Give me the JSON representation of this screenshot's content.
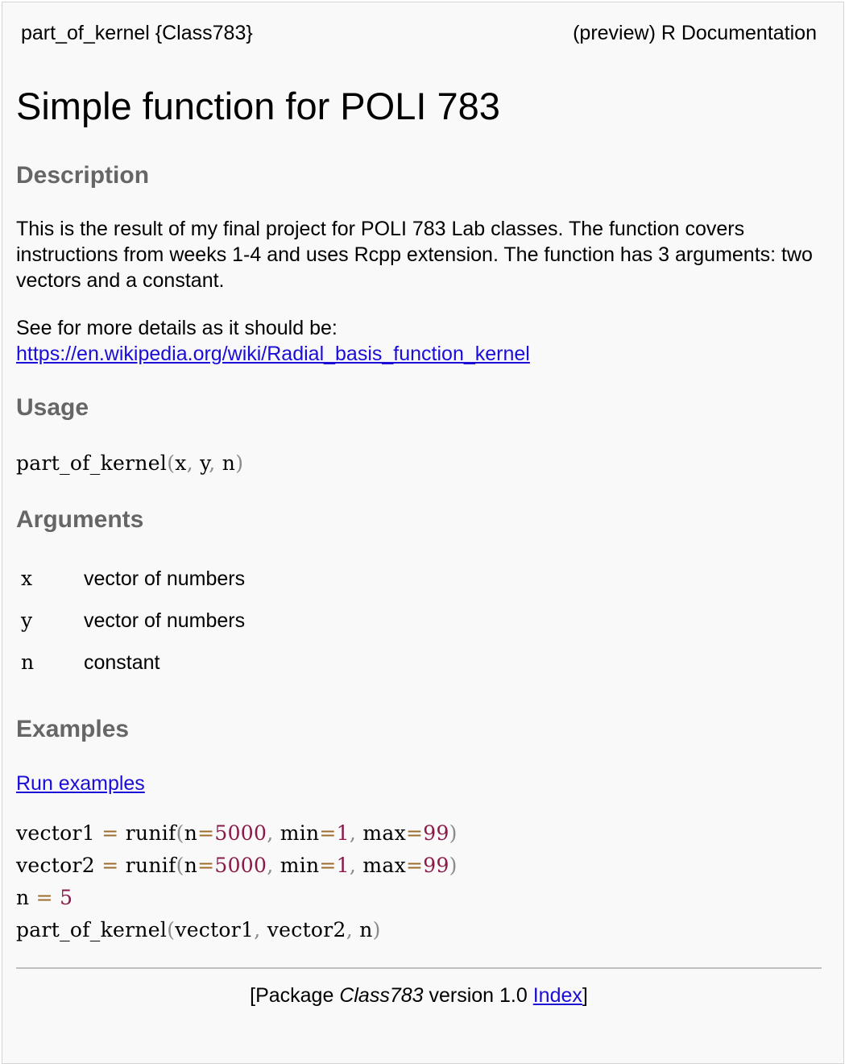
{
  "header": {
    "topic": "part_of_kernel {Class783}",
    "source": "(preview) R Documentation"
  },
  "title": "Simple function for POLI 783",
  "description": {
    "heading": "Description",
    "paragraph1": "This is the result of my final project for POLI 783 Lab classes. The function covers instructions from weeks 1-4 and uses Rcpp extension. The function has 3 arguments: two vectors and a constant.",
    "paragraph2_text": "See for more details as it should be:",
    "link": "https://en.wikipedia.org/wiki/Radial_basis_function_kernel"
  },
  "usage": {
    "heading": "Usage",
    "fn": "part_of_kernel",
    "open": "(",
    "arg_x": "x",
    "arg_y": "y",
    "arg_n": "n",
    "comma": ",",
    "close": ")"
  },
  "arguments": {
    "heading": "Arguments",
    "items": [
      {
        "name": "x",
        "desc": "vector of numbers"
      },
      {
        "name": "y",
        "desc": "vector of numbers"
      },
      {
        "name": "n",
        "desc": "constant"
      }
    ]
  },
  "examples": {
    "heading": "Examples",
    "run_link": "Run examples",
    "line1": {
      "var": "vector1",
      "eq": "=",
      "fn": "runif",
      "p1": "n",
      "v1": "5000",
      "p2": "min",
      "v2": "1",
      "p3": "max",
      "v3": "99"
    },
    "line2": {
      "var": "vector2",
      "eq": "=",
      "fn": "runif",
      "p1": "n",
      "v1": "5000",
      "p2": "min",
      "v2": "1",
      "p3": "max",
      "v3": "99"
    },
    "line3": {
      "var": "n",
      "eq": "=",
      "val": "5"
    },
    "line4": {
      "fn": "part_of_kernel",
      "a1": "vector1",
      "a2": "vector2",
      "a3": "n"
    },
    "open": "(",
    "close": ")",
    "comma": ",",
    "assign": "="
  },
  "footer": {
    "prefix": "[Package ",
    "package": "Class783",
    "version": " version 1.0 ",
    "index_link": "Index",
    "suffix": "]"
  }
}
